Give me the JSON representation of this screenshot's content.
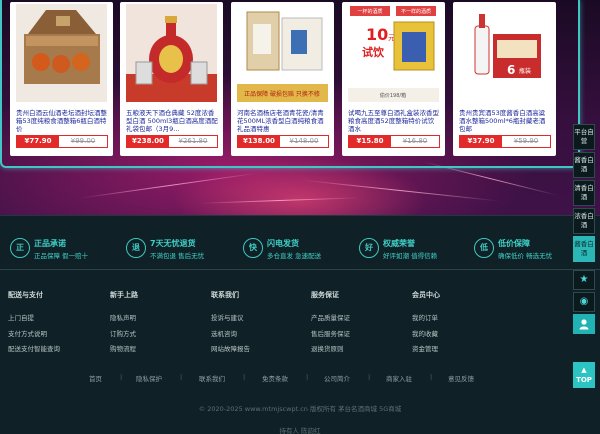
{
  "products": [
    {
      "name": "贵州白酒云仙酒老坛酒封坛酒整箱53度纯粮食酒整箱6瓶白酒特价",
      "price": "¥77.90",
      "old_price": "¥99.00"
    },
    {
      "name": "五粮液天下酒仓典藏 52度浓香型白酒 500ml3瓶白酒高度酒配礼袋包邮（3月9...",
      "price": "¥238.00",
      "old_price": "¥261.80"
    },
    {
      "name": "河南名酒杨店老酒青花瓷/清青花500ML浓香型白酒纯粮食酒礼品酒特惠",
      "price": "¥138.00",
      "old_price": "¥148.00"
    },
    {
      "name": "试喝九五至尊白酒礼盒装浓香型粮食高度酒52度整箱特价试饮酒水",
      "price": "¥15.80",
      "old_price": "¥16.80"
    },
    {
      "name": "贵州贵宾酒53度酱香白酒高粱酒水整箱500ml*6瓶封藏老酒包邮",
      "price": "¥37.90",
      "old_price": "¥59.90"
    }
  ],
  "image_text": {
    "p3_banner": "正品保障 破损包赔 只换不修",
    "p4_top_left": "一杯的酒质",
    "p4_top_right": "不一样的酒质",
    "p4_num": "10",
    "p4_unit": "元",
    "p4_big": "试饮",
    "p4_bottom": "偷价198/箱",
    "p5_num": "6",
    "p5_unit": "瓶装"
  },
  "promises": [
    {
      "icon": "正",
      "title": "正品承诺",
      "sub": "正品保障 假一赔十"
    },
    {
      "icon": "退",
      "title": "7天无忧退货",
      "sub": "不满包退 售后无忧"
    },
    {
      "icon": "快",
      "title": "闪电发货",
      "sub": "多仓直发 急速配送"
    },
    {
      "icon": "好",
      "title": "权威荣誉",
      "sub": "好评如潮 值得信赖"
    },
    {
      "icon": "低",
      "title": "低价保障",
      "sub": "确保低价 畅选无忧"
    }
  ],
  "link_columns": [
    {
      "title": "配送与支付",
      "links": [
        "上门自提",
        "支付方式说明",
        "配送支付智能查询"
      ]
    },
    {
      "title": "新手上路",
      "links": [
        "隐私声明",
        "订购方式",
        "购物流程"
      ]
    },
    {
      "title": "联系我们",
      "links": [
        "投诉与建议",
        "选机咨询",
        "网站故障报告"
      ]
    },
    {
      "title": "服务保证",
      "links": [
        "产品质量保证",
        "售后服务保证",
        "退换货原则"
      ]
    },
    {
      "title": "会员中心",
      "links": [
        "我的订单",
        "我的收藏",
        "资金管理"
      ]
    }
  ],
  "bottom_nav": [
    "首页",
    "隐私保护",
    "联系我们",
    "免责条款",
    "公司简介",
    "商家入驻",
    "意见反馈"
  ],
  "copyright": "© 2020-2025 www.mtmjscwpt.cn 版权所有 茅台名酒商城 5G商城",
  "holder": "持有人 陈韵红",
  "right_categories": [
    "平台自营",
    "酱香白酒",
    "清香白酒",
    "浓香白酒",
    "酱香白酒"
  ],
  "top_button": "TOP",
  "icons": {
    "star": "star-icon",
    "eye": "eye-icon",
    "user": "user-icon",
    "up": "arrow-up-icon"
  },
  "colors": {
    "accent": "#3fc7c0",
    "price_red": "#e32a2a",
    "name_blue": "#1f2a99"
  }
}
